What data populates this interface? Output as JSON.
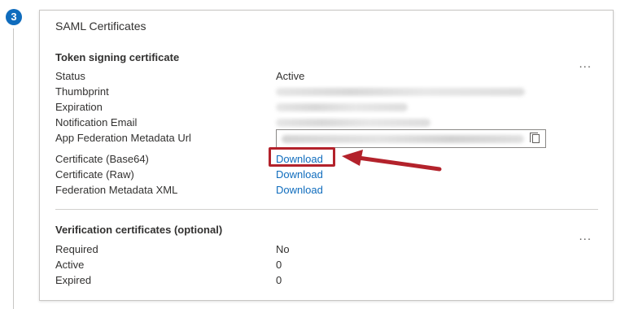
{
  "step": {
    "number": "3"
  },
  "card": {
    "title": "SAML Certificates"
  },
  "token_signing": {
    "title": "Token signing certificate",
    "more_label": "...",
    "rows": {
      "status_label": "Status",
      "status_value": "Active",
      "thumbprint_label": "Thumbprint",
      "expiration_label": "Expiration",
      "notification_label": "Notification Email",
      "metadata_url_label": "App Federation Metadata Url",
      "cert_base64_label": "Certificate (Base64)",
      "cert_base64_link": "Download",
      "cert_raw_label": "Certificate (Raw)",
      "cert_raw_link": "Download",
      "fed_xml_label": "Federation Metadata XML",
      "fed_xml_link": "Download"
    }
  },
  "verification": {
    "title": "Verification certificates (optional)",
    "more_label": "...",
    "rows": {
      "required_label": "Required",
      "required_value": "No",
      "active_label": "Active",
      "active_value": "0",
      "expired_label": "Expired",
      "expired_value": "0"
    }
  },
  "colors": {
    "accent": "#0f6cbd",
    "annotation": "#b3222b"
  },
  "icons": [
    "more-options-icon",
    "copy-icon",
    "annotation-arrow-icon"
  ]
}
